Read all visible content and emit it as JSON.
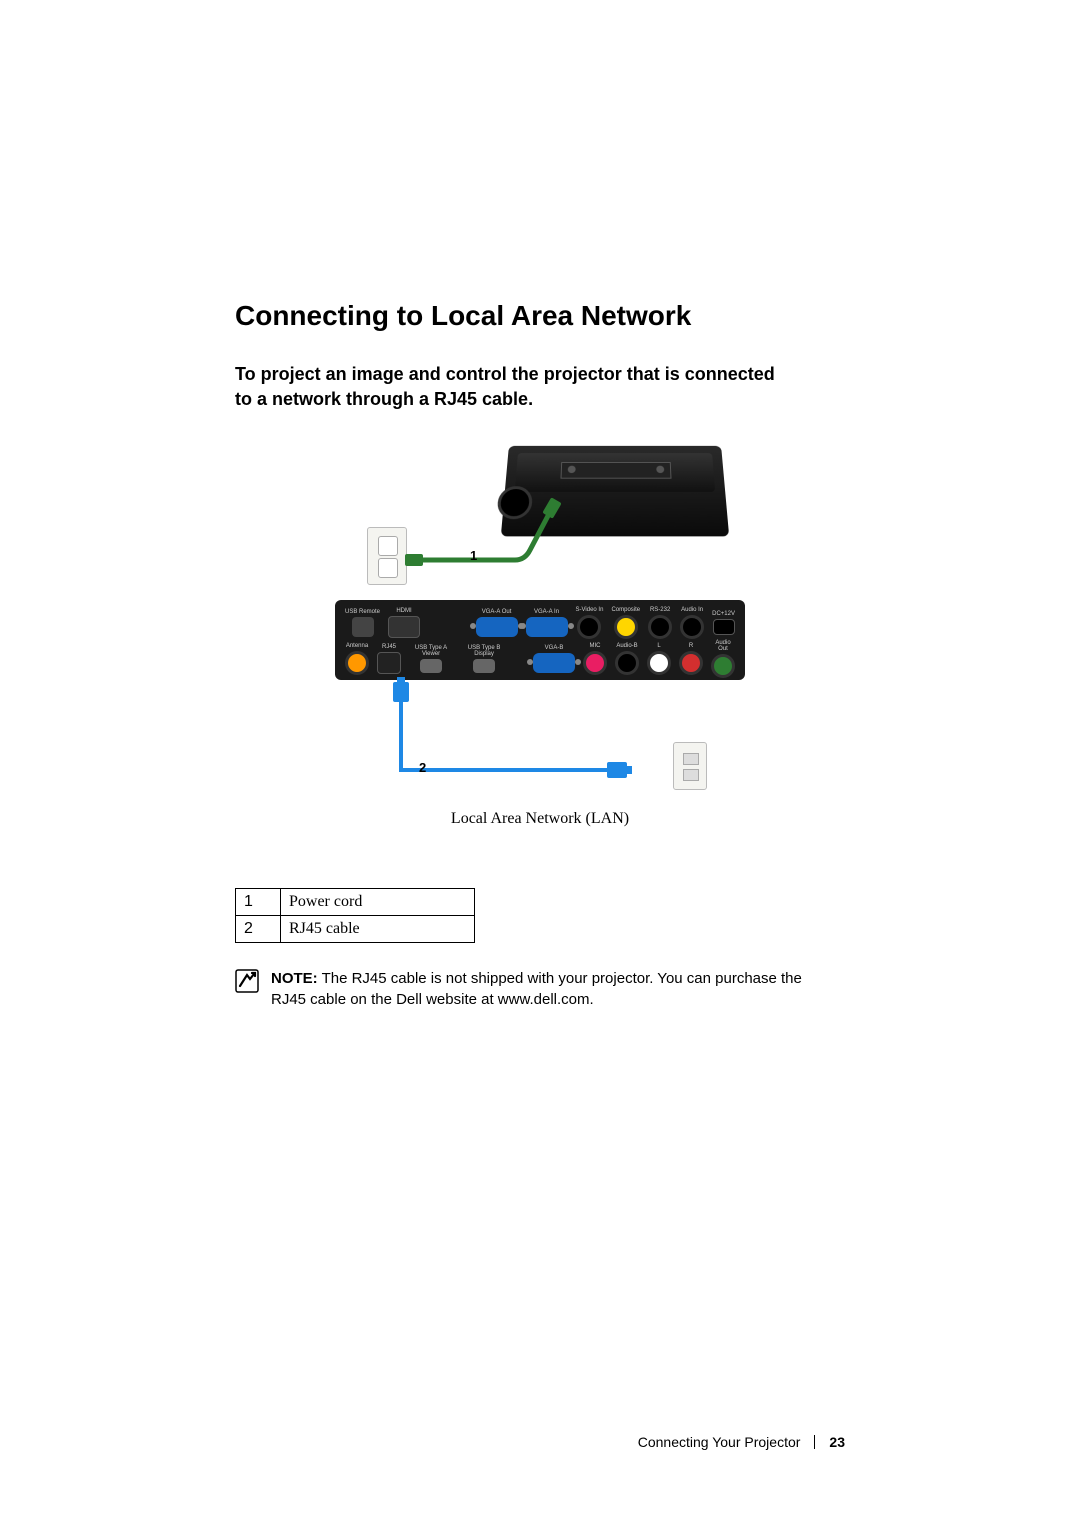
{
  "heading": "Connecting to Local Area Network",
  "subheading": "To project an image and control the projector that is connected to a network through a RJ45 cable.",
  "diagram": {
    "callout_1": "1",
    "callout_2": "2",
    "caption": "Local Area Network (LAN)",
    "ports": {
      "usb_remote": "USB Remote",
      "hdmi": "HDMI",
      "vga_a_out": "VGA-A Out",
      "vga_a_in": "VGA-A In",
      "svideo": "S-Video In",
      "composite": "Composite",
      "rs232": "RS-232",
      "audio_in": "Audio In",
      "dc12v": "DC+12V",
      "antenna": "Antenna",
      "rj45": "RJ45",
      "usb_a": "USB Type A Viewer",
      "usb_b": "USB Type B Display",
      "vga_b": "VGA-B",
      "mic": "MIC",
      "audio_b": "Audio-B",
      "audio_lr_l": "L",
      "audio_lr_r": "R",
      "audio_out": "Audio Out"
    }
  },
  "legend": [
    {
      "num": "1",
      "desc": "Power cord"
    },
    {
      "num": "2",
      "desc": "RJ45 cable"
    }
  ],
  "note": {
    "label": "NOTE:",
    "text": " The RJ45 cable is not shipped with your projector. You can purchase the RJ45 cable on the Dell website at www.dell.com."
  },
  "footer": {
    "section": "Connecting Your Projector",
    "page": "23"
  }
}
